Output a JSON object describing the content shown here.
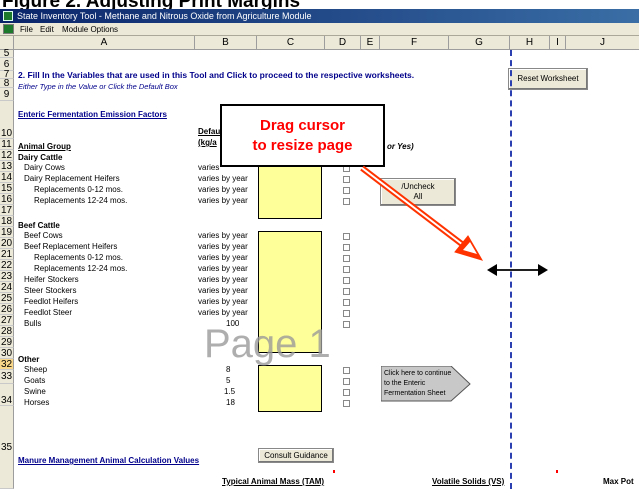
{
  "figure_title": "Figure 2. Adjusting Print Margins",
  "window_title": "State Inventory Tool - Methane and Nitrous Oxide from Agriculture Module",
  "menu": [
    "File",
    "Edit",
    "Module Options"
  ],
  "columns": [
    "A",
    "B",
    "C",
    "D",
    "E",
    "F",
    "G",
    "H",
    "I",
    "J"
  ],
  "rows": [
    "5",
    "6",
    "7",
    "8",
    "9",
    "10",
    "11",
    "12",
    "13",
    "14",
    "15",
    "16",
    "17",
    "18",
    "19",
    "20",
    "21",
    "22",
    "23",
    "24",
    "25",
    "26",
    "27",
    "28",
    "29",
    "30",
    "32",
    "33",
    "34",
    "35"
  ],
  "selected_row": "32",
  "instructions": {
    "heading": "2. Fill In the Variables that are used in this Tool and Click to proceed to the respective worksheets.",
    "subheading": "Either Type in the Value or Click the Default Box"
  },
  "section_enteric": "Enteric Fermentation Emission Factors",
  "col_headers": {
    "animal_group": "Animal Group",
    "default_line1": "Default",
    "default_line2": "(kg/a",
    "yes_fragment": "or Yes)"
  },
  "groups": {
    "dairy": "Dairy Cattle",
    "beef": "Beef Cattle",
    "other": "Other"
  },
  "animals": [
    {
      "name": "Dairy Cows",
      "value": "varies"
    },
    {
      "name": "Dairy Replacement Heifers",
      "value": "varies by year"
    },
    {
      "name": "Replacements 0-12 mos.",
      "value": "varies by year"
    },
    {
      "name": "Replacements 12-24 mos.",
      "value": "varies by year"
    },
    {
      "name": "Beef Cows",
      "value": "varies by year"
    },
    {
      "name": "Beef Replacement Heifers",
      "value": "varies by year"
    },
    {
      "name": "Replacements 0-12 mos.",
      "value": "varies by year"
    },
    {
      "name": "Replacements 12-24 mos.",
      "value": "varies by year"
    },
    {
      "name": "Heifer Stockers",
      "value": "varies by year"
    },
    {
      "name": "Steer Stockers",
      "value": "varies by year"
    },
    {
      "name": "Feedlot Heifers",
      "value": "varies by year"
    },
    {
      "name": "Feedlot Steer",
      "value": "varies by year"
    },
    {
      "name": "Bulls",
      "value": "100"
    },
    {
      "name": "Sheep",
      "value": "8"
    },
    {
      "name": "Goats",
      "value": "5"
    },
    {
      "name": "Swine",
      "value": "1.5"
    },
    {
      "name": "Horses",
      "value": "18"
    }
  ],
  "buttons": {
    "reset": "Reset Worksheet",
    "check_line1": "/Uncheck",
    "check_line2": "All",
    "continue_line1": "Click here to continue",
    "continue_line2": "to the Enteric",
    "continue_line3": "Fermentation Sheet",
    "consult": "Consult Guidance"
  },
  "section_manure": "Manure Management Animal Calculation Values",
  "bottom_headers": {
    "tam": "Typical Animal Mass (TAM)",
    "vs": "Volatile Solids (VS)",
    "maxpot": "Max Pot"
  },
  "callout": {
    "line1": "Drag cursor",
    "line2": "to resize page"
  },
  "watermark": "Page 1",
  "colors": {
    "callout_text": "#ff0000",
    "arrow": "#ff3300",
    "page_break": "#2c3fb0",
    "input_fill": "#ffff99",
    "header_text": "#00008b"
  }
}
